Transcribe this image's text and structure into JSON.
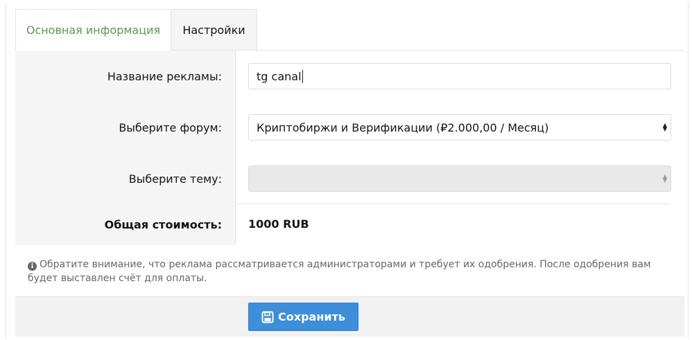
{
  "tabs": [
    {
      "label": "Основная информация",
      "active": true
    },
    {
      "label": "Настройки",
      "active": false
    }
  ],
  "form": {
    "ad_name_label": "Название рекламы:",
    "ad_name_value": "tg canal",
    "forum_label": "Выберите форум:",
    "forum_selected": "Криптобиржи и Верификации (₽2.000,00 / Месяц)",
    "topic_label": "Выберите тему:",
    "topic_selected": "",
    "total_label": "Общая стоимость:",
    "total_value": "1000 RUB"
  },
  "notice": {
    "icon": "info-icon",
    "text": "Обратите внимание, что реклама рассматривается администраторами и требует их одобрения. После одобрения вам будет выставлен счёт для оплаты."
  },
  "actions": {
    "save_label": "Сохранить",
    "save_icon": "floppy-disk-icon"
  },
  "colors": {
    "active_tab_text": "#5a9a4f",
    "save_button": "#3d8fd9"
  }
}
